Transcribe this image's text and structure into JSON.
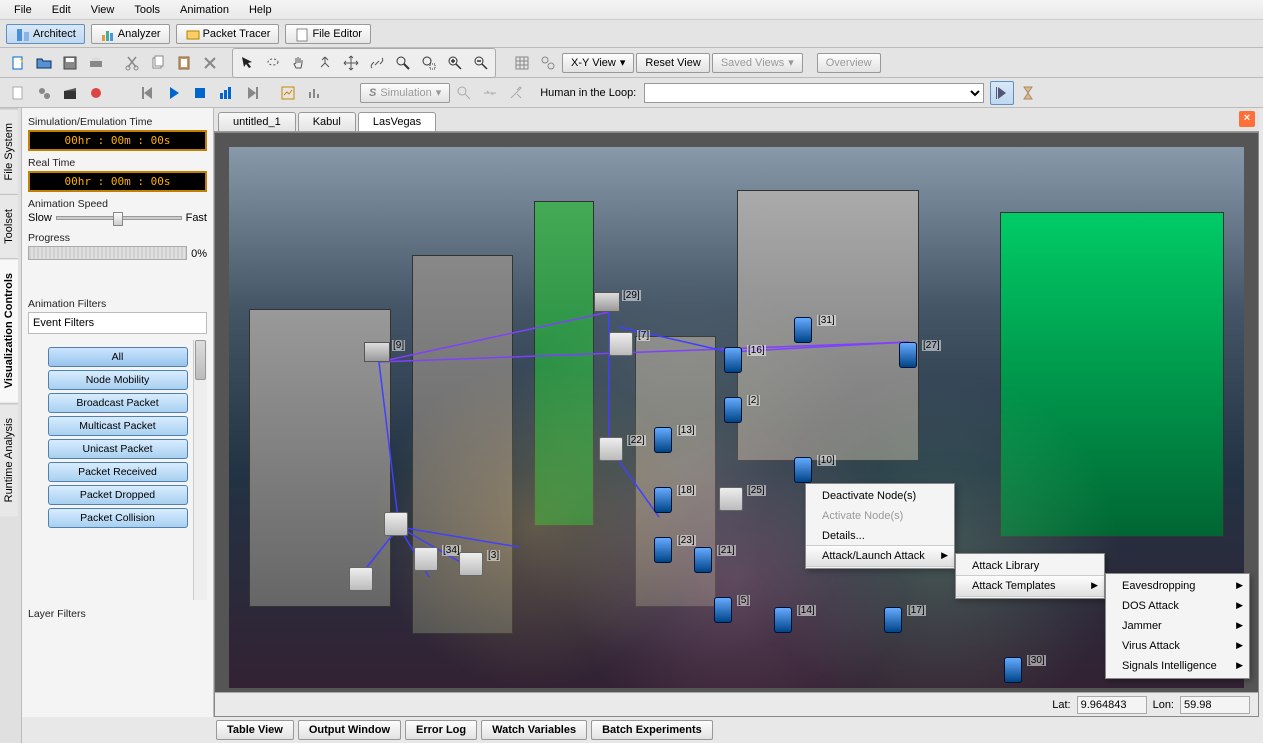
{
  "menu": {
    "items": [
      "File",
      "Edit",
      "View",
      "Tools",
      "Animation",
      "Help"
    ]
  },
  "modes": {
    "architect": "Architect",
    "analyzer": "Analyzer",
    "packet_tracer": "Packet Tracer",
    "file_editor": "File Editor"
  },
  "tool2": {
    "view_sel": "X-Y View",
    "reset": "Reset View",
    "saved": "Saved Views",
    "overview": "Overview"
  },
  "tool3": {
    "sim": "Simulation",
    "human_label": "Human in the Loop:"
  },
  "left": {
    "sim_time_label": "Simulation/Emulation Time",
    "sim_time": "00hr : 00m : 00s",
    "real_time_label": "Real Time",
    "real_time": "00hr : 00m : 00s",
    "anim_speed": "Animation Speed",
    "slow": "Slow",
    "fast": "Fast",
    "progress": "Progress",
    "progress_pct": "0%",
    "anim_filters": "Animation Filters",
    "event_filters": "Event Filters",
    "layer_filters": "Layer Filters",
    "filters": [
      "All",
      "Node Mobility",
      "Broadcast Packet",
      "Multicast Packet",
      "Unicast Packet",
      "Packet Received",
      "Packet Dropped",
      "Packet Collision"
    ]
  },
  "vtabs": {
    "runtime": "Runtime Analysis",
    "viz": "Visualization Controls",
    "toolset": "Toolset",
    "fs": "File System"
  },
  "doctabs": {
    "t0": "untitled_1",
    "t1": "Kabul",
    "t2": "LasVegas"
  },
  "nodes": {
    "n9": "[9]",
    "n29": "[29]",
    "n7": "[7]",
    "n31": "[31]",
    "n16": "[16]",
    "n27": "[27]",
    "n22": "[22]",
    "n13": "[13]",
    "n2": "[2]",
    "n18": "[18]",
    "n25": "[25]",
    "n10": "[10]",
    "n34": "[34]",
    "n3": "[3]",
    "n23": "[23]",
    "n21": "[21]",
    "n5": "[5]",
    "n14": "[14]",
    "n17": "[17]",
    "n30": "[30]"
  },
  "ctx1": {
    "deactivate": "Deactivate Node(s)",
    "activate": "Activate Node(s)",
    "details": "Details...",
    "attack": "Attack/Launch Attack"
  },
  "ctx2": {
    "library": "Attack Library",
    "templates": "Attack Templates"
  },
  "ctx3": {
    "eaves": "Eavesdropping",
    "dos": "DOS Attack",
    "jammer": "Jammer",
    "virus": "Virus Attack",
    "sigint": "Signals Intelligence"
  },
  "status": {
    "lat_label": "Lat:",
    "lat": "9.964843",
    "lon_label": "Lon:",
    "lon": "59.98"
  },
  "bottom": {
    "t0": "Table View",
    "t1": "Output Window",
    "t2": "Error Log",
    "t3": "Watch Variables",
    "t4": "Batch Experiments"
  }
}
